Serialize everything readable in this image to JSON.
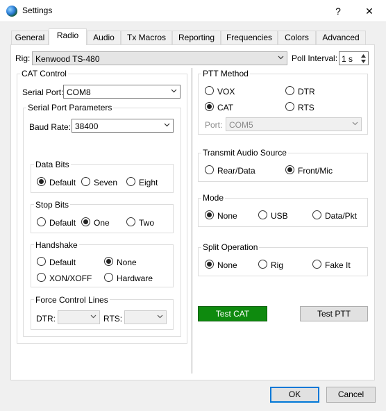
{
  "window": {
    "title": "Settings",
    "help": "?",
    "close": "✕"
  },
  "tabs": [
    {
      "label": "General"
    },
    {
      "label": "Radio"
    },
    {
      "label": "Audio"
    },
    {
      "label": "Tx Macros"
    },
    {
      "label": "Reporting"
    },
    {
      "label": "Frequencies"
    },
    {
      "label": "Colors"
    },
    {
      "label": "Advanced"
    }
  ],
  "rig": {
    "label": "Rig:",
    "value": "Kenwood TS-480"
  },
  "poll": {
    "label": "Poll Interval:",
    "value": "1 s"
  },
  "cat": {
    "title": "CAT Control",
    "serial_port_label": "Serial Port:",
    "serial_port_value": "COM8",
    "params_title": "Serial Port Parameters",
    "baud_label": "Baud Rate:",
    "baud_value": "38400",
    "data_bits": {
      "title": "Data Bits",
      "options": [
        "Default",
        "Seven",
        "Eight"
      ],
      "selected": "Default"
    },
    "stop_bits": {
      "title": "Stop Bits",
      "options": [
        "Default",
        "One",
        "Two"
      ],
      "selected": "One"
    },
    "handshake": {
      "title": "Handshake",
      "options": [
        "Default",
        "None",
        "XON/XOFF",
        "Hardware"
      ],
      "selected": "None"
    },
    "force": {
      "title": "Force Control Lines",
      "dtr_label": "DTR:",
      "rts_label": "RTS:"
    }
  },
  "ptt": {
    "title": "PTT Method",
    "options": [
      "VOX",
      "DTR",
      "CAT",
      "RTS"
    ],
    "selected": "CAT",
    "port_label": "Port:",
    "port_value": "COM5"
  },
  "tx_audio": {
    "title": "Transmit Audio Source",
    "options": [
      "Rear/Data",
      "Front/Mic"
    ],
    "selected": "Front/Mic"
  },
  "mode": {
    "title": "Mode",
    "options": [
      "None",
      "USB",
      "Data/Pkt"
    ],
    "selected": "None"
  },
  "split": {
    "title": "Split Operation",
    "options": [
      "None",
      "Rig",
      "Fake It"
    ],
    "selected": "None"
  },
  "buttons": {
    "test_cat": "Test CAT",
    "test_ptt": "Test PTT",
    "ok": "OK",
    "cancel": "Cancel"
  },
  "colors": {
    "test_cat_bg": "#0e8a0e",
    "default_button_border": "#0078d7"
  }
}
